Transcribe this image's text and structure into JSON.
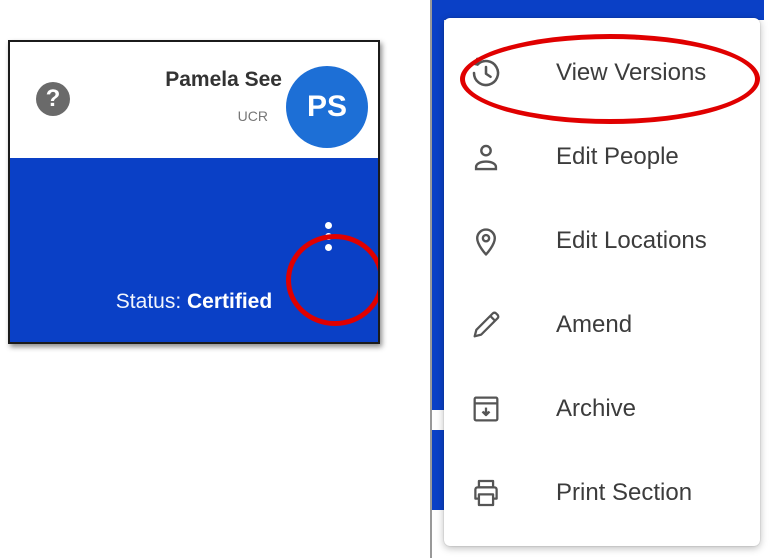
{
  "card": {
    "user_name": "Pamela See",
    "user_org": "UCR",
    "avatar_initials": "PS",
    "help_icon": "?",
    "status_label": "Status: ",
    "status_value": "Certified",
    "colors": {
      "header_blue": "#0a40c6",
      "avatar_blue": "#1d6fd6",
      "help_gray": "#6a6a6a"
    }
  },
  "menu": {
    "items": [
      {
        "label": "View Versions",
        "icon": "history-icon"
      },
      {
        "label": "Edit People",
        "icon": "person-icon"
      },
      {
        "label": "Edit Locations",
        "icon": "location-pin-icon"
      },
      {
        "label": "Amend",
        "icon": "pencil-icon"
      },
      {
        "label": "Archive",
        "icon": "archive-icon"
      },
      {
        "label": "Print Section",
        "icon": "printer-icon"
      }
    ]
  },
  "annotations": {
    "highlight_color": "#e00000"
  }
}
